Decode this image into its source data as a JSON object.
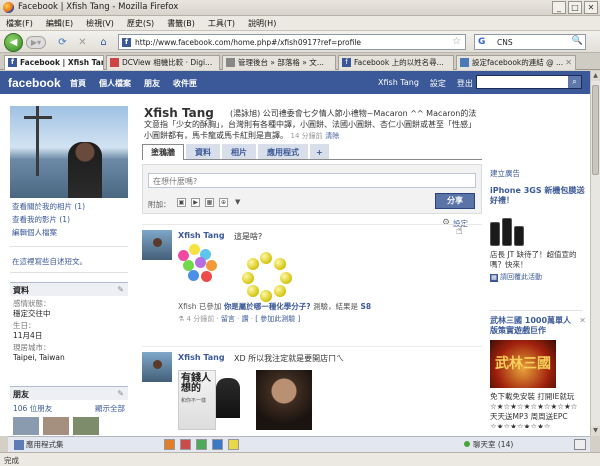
{
  "window": {
    "title": "Facebook | Xfish Tang - Mozilla Firefox",
    "min": "_",
    "max": "□",
    "close": "✕"
  },
  "menu": [
    "檔案(F)",
    "編輯(E)",
    "檢視(V)",
    "歷史(S)",
    "書籤(B)",
    "工具(T)",
    "說明(H)"
  ],
  "nav": {
    "back_icon": "back-arrow-icon",
    "url": "http://www.facebook.com/home.php#/xfish0917?ref=profile",
    "search_engine": "G",
    "search_value": "CNS"
  },
  "tabs": [
    "Facebook | Xfish Tang",
    "DCView 相機比較 · Digi...",
    "管理後台 » 部落格 » 文...",
    "Facebook 上的以姓名尋...",
    "設定facebook的連結 @ ..."
  ],
  "fb": {
    "logo": "facebook",
    "nav": [
      "首頁",
      "個人檔案",
      "朋友",
      "收件匣"
    ],
    "right": [
      "Xfish Tang",
      "設定",
      "登出"
    ],
    "search_placeholder": ""
  },
  "profile": {
    "name": "Xfish Tang",
    "status_text": "(湯詠旭) 公司禮委會七夕情人節小禮物~Macaron ^^ Macaron的法文意指「少女的酥胸」，台灣則有各種中譯，小圓餅、法國小圓餅、杏仁小圓餅或甚至「性感」小圓餅都有，馬卡龍或馬卡紅則是直譯。",
    "status_time": "14 分鐘前",
    "status_delete": "清除",
    "tabs": [
      "塗鴉牆",
      "資料",
      "相片",
      "應用程式",
      "+"
    ]
  },
  "left": {
    "links": [
      "查看關於我的相片 (1)",
      "查看我的影片 (1)",
      "編輯個人檔案"
    ],
    "wall_setting": "在這裡寫些自述短文。",
    "info_title": "資料",
    "info": [
      {
        "k": "感情狀態：",
        "v": "穩定交往中"
      },
      {
        "k": "生日：",
        "v": "11月4日"
      },
      {
        "k": "現居城市：",
        "v": "Taipei, Taiwan"
      }
    ],
    "friends_title": "朋友",
    "friends_count": "106 位朋友",
    "friends_all": "顯示全部"
  },
  "composer": {
    "placeholder": "在想什麼嗎?",
    "attach_label": "附加：",
    "share": "分享",
    "settings": "設定"
  },
  "stories": [
    {
      "name": "Xfish Tang",
      "message": "這是啥?",
      "quiz_prefix": "Xfish 已參加",
      "quiz_title": "你是屬於哪一種化學分子?",
      "quiz_suffix": "測驗，結果是",
      "quiz_result": "S8",
      "time": "4 分鐘前",
      "comment": "留言",
      "like": "讚",
      "join": "[ 參加此測驗 ]"
    },
    {
      "name": "Xfish Tang",
      "message": "XD 所以我注定就是要開店ㄇㄟ",
      "movie_title": "有錢人想的",
      "movie_sub": "和你不一樣"
    }
  ],
  "right": {
    "create_ad": "建立廣告",
    "ad1": {
      "title": "iPhone 3GS 新機包膜送好禮！",
      "body": "店長 JT 缺待了！超值宣的 嗎？快來！",
      "like": "請回覆此活動"
    },
    "ad2": {
      "title": "武林三國 1000萬單人版策實遊戲巨作",
      "banner": "武林三國",
      "body": "免下載免安裝 打開IE就玩 ☆★☆★☆★☆★☆★☆★☆ 天天送MP3 周周送EPC ☆★☆★☆★☆★☆"
    }
  },
  "bottom": {
    "apps": "應用程式集",
    "chat": "聊天室 (14)"
  },
  "status": "完成"
}
